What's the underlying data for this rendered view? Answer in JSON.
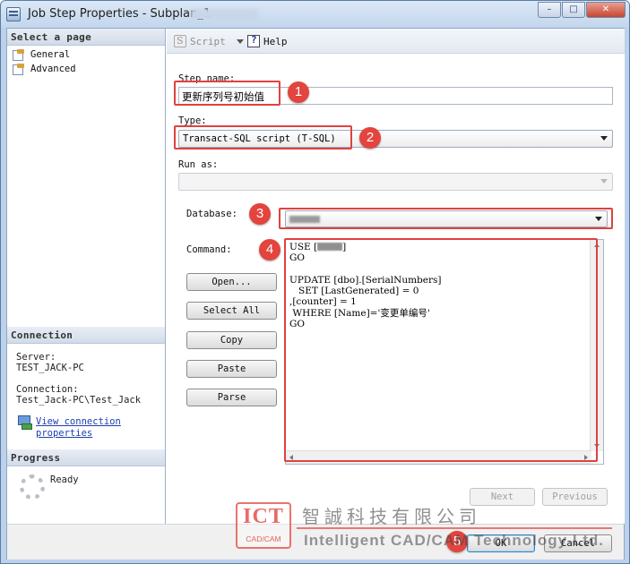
{
  "window": {
    "title": "Job Step Properties - Subplan_1",
    "minimize_glyph": "–",
    "maximize_glyph": "□",
    "close_glyph": "✕"
  },
  "left_panel": {
    "select_page_header": "Select a page",
    "pages": [
      {
        "label": "General",
        "icon": "page-icon"
      },
      {
        "label": "Advanced",
        "icon": "page-icon"
      }
    ],
    "connection_header": "Connection",
    "server_label": "Server:",
    "server_value": "TEST_JACK-PC",
    "connection_label": "Connection:",
    "connection_value": "Test_Jack-PC\\Test_Jack",
    "view_connection_line1": "View connection",
    "view_connection_line2": "properties",
    "progress_header": "Progress",
    "progress_status": "Ready"
  },
  "toolbar": {
    "script_label": "Script",
    "help_label": "Help"
  },
  "form": {
    "step_name_label": "Step name:",
    "step_name_value": "更新序列号初始值",
    "type_label": "Type:",
    "type_value": "Transact-SQL script (T-SQL)",
    "run_as_label": "Run as:",
    "run_as_value": "",
    "database_label": "Database:",
    "database_value": "",
    "command_label": "Command:",
    "command_lines": {
      "l1": "USE [",
      "l1_end": "]",
      "l2": "GO",
      "l3": "",
      "l4": "UPDATE [dbo].[SerialNumbers]",
      "l5": "   SET [LastGenerated] = 0",
      ",[counter] = 1": "",
      "l6": ",[counter] = 1",
      "l7": " WHERE [Name]='变更单编号'",
      "l8": "GO"
    }
  },
  "buttons": {
    "open": "Open...",
    "select_all": "Select All",
    "copy": "Copy",
    "paste": "Paste",
    "parse": "Parse",
    "next": "Next",
    "previous": "Previous",
    "ok": "OK",
    "cancel": "Cancel"
  },
  "callouts": [
    "1",
    "2",
    "3",
    "4",
    "5"
  ],
  "watermark": {
    "logo_text": "ICT",
    "logo_sub": "CAD/CAM",
    "chinese": "智誠科技有限公司",
    "english": "Intelligent CAD/CAM Technology Ltd."
  },
  "colors": {
    "callout_red": "#e3443e",
    "title_gradient_top": "#dbe8f6",
    "link_blue": "#1c3fb0"
  }
}
